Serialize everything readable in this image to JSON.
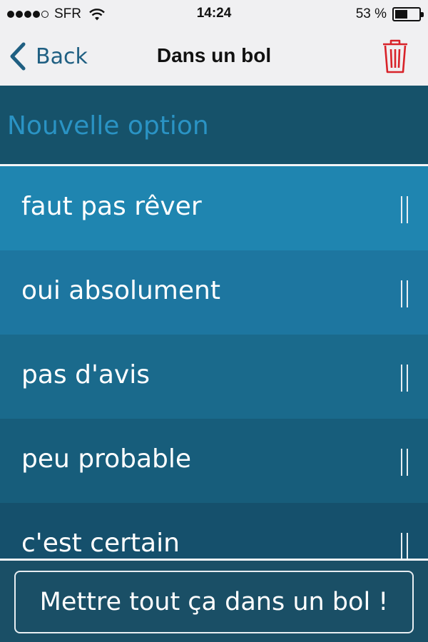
{
  "status_bar": {
    "carrier": "SFR",
    "time": "14:24",
    "battery_percent": "53 %",
    "battery_level": 0.53,
    "signal_bars_filled": 4,
    "signal_bars_total": 5
  },
  "nav": {
    "back_label": "Back",
    "title": "Dans un bol",
    "trash_icon": "trash-icon",
    "trash_color": "#d8232a",
    "accent_color": "#1f5f82"
  },
  "new_option": {
    "placeholder": "Nouvelle option",
    "value": ""
  },
  "options": [
    {
      "label": "faut pas rêver",
      "color": "#1f85b0"
    },
    {
      "label": "oui absolument",
      "color": "#1d76a0"
    },
    {
      "label": "pas d'avis",
      "color": "#1a6a8c"
    },
    {
      "label": "peu probable",
      "color": "#175d7b"
    },
    {
      "label": "c'est certain",
      "color": "#15506c"
    }
  ],
  "action_button": {
    "label": "Mettre tout ça dans un bol !"
  }
}
